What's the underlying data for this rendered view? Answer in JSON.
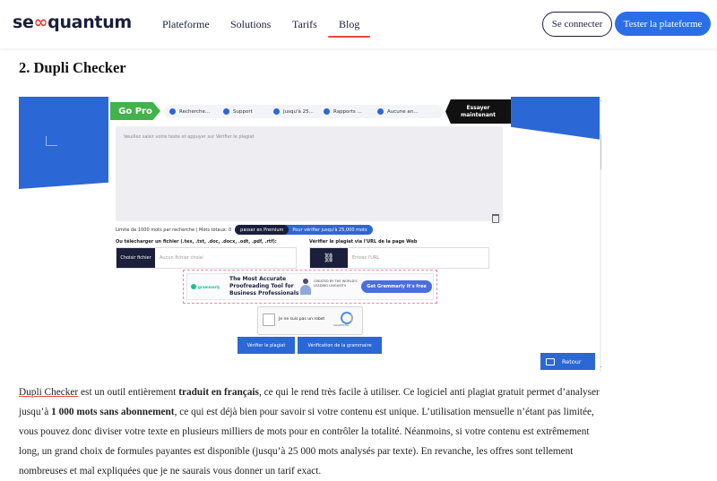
{
  "header": {
    "logo_left": "se",
    "logo_inf": "∞",
    "logo_right": "quantum",
    "nav": [
      "Plateforme",
      "Solutions",
      "Tarifs",
      "Blog"
    ],
    "active_nav": "Blog",
    "login_label": "Se connecter",
    "cta_label": "Tester la plateforme",
    "accent_color": "#e5483b",
    "brand_color": "#2b6fe8"
  },
  "article": {
    "heading": "2. Dupli Checker",
    "paragraph": {
      "link": "Dupli Checker",
      "t1": " est un outil entièrement ",
      "b1": "traduit en français",
      "t2": ", ce qui le rend très facile à utiliser. Ce logiciel anti plagiat gratuit permet d’analyser jusqu’à ",
      "b2": "1 000 mots sans abonnement",
      "t3": ", ce qui est déjà bien pour savoir si votre contenu est unique. L’utilisation mensuelle n’étant pas limitée, vous pouvez donc diviser votre texte en plusieurs milliers de mots pour en contrôler la totalité. Néanmoins, si votre contenu est extrêmement long, un grand choix de formules payantes est disponible (jusqu’à 25 000 mots analysés par texte). En revanche, les offres sont tellement nombreuses et mal expliquées que je ne saurais vous donner un tarif exact."
    }
  },
  "screenshot": {
    "gopro": "Go Pro",
    "chips": [
      "Recherche...",
      "Support",
      "Jusqu'à 25...",
      "Rapports ...",
      "Aucune an..."
    ],
    "try_now_1": "Essayer",
    "try_now_2": "maintenant",
    "textarea_placeholder": "Veuillez saisir votre texte et appuyer sur Vérifier le plagiat",
    "limit_text": "Limite de 1000 mots par recherche | Mots totaux: 0",
    "premium_dark": "passer en Premium",
    "premium_text": "Pour vérifier jusqu'à 25,000 mots",
    "upload_label": "Ou télécharger un fichier (.tex, .txt, .doc, .docx, .odt, .pdf, .rtf):",
    "url_label": "Vérifier le plagiat via l'URL de la page Web",
    "file_button": "Choisir fichier",
    "file_placeholder": "Aucun fichier choisi",
    "url_icon": "link-icon",
    "url_placeholder": "Entrez l'URL",
    "ad": {
      "brand": "grammarly",
      "title": "The Most Accurate Proofreading Tool for Business Professionals",
      "created": "CREATED BY THE WORLD'S LEADING LINGUISTS",
      "cta": "Get Grammarly It's free"
    },
    "captcha_label": "Je ne suis pas un robot",
    "captcha_small": "reCAPTCHA",
    "btn_plagiat": "Vérifier le plagiat",
    "btn_grammaire": "Vérification de la grammaire",
    "retour": "Retour"
  }
}
